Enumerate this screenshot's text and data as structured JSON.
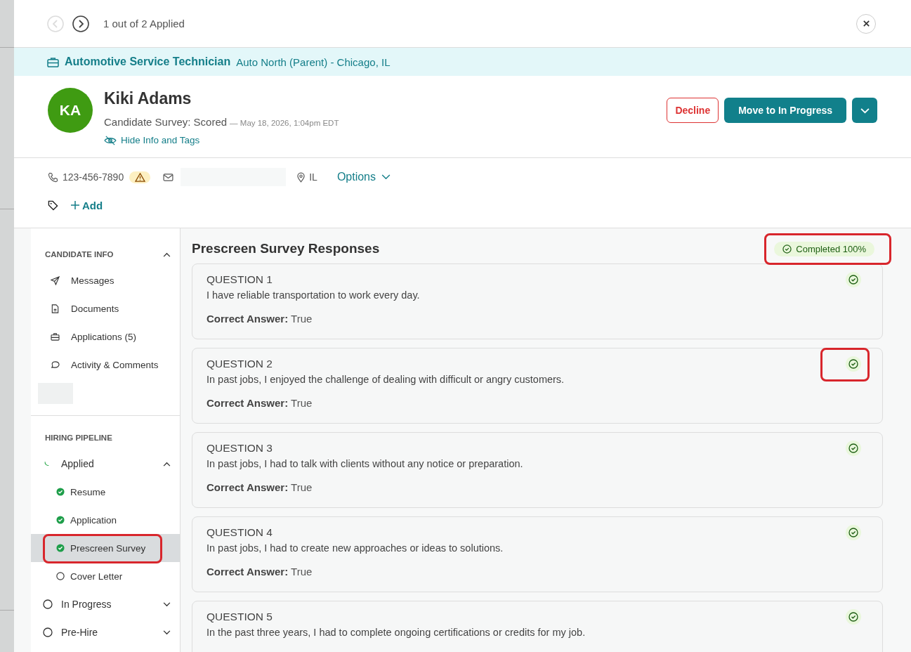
{
  "header": {
    "pager": "1 out of 2 Applied",
    "prev_disabled": true
  },
  "job": {
    "title": "Automotive Service Technician",
    "location": "Auto North (Parent) - Chicago, IL"
  },
  "candidate": {
    "initials": "KA",
    "name": "Kiki Adams",
    "status": "Candidate Survey: Scored",
    "timestamp": "— May 18, 2026, 1:04pm EDT",
    "toggle": "Hide Info and Tags"
  },
  "actions": {
    "decline": "Decline",
    "primary": "Move to In Progress"
  },
  "contact": {
    "phone": "123-456-7890",
    "phone_warning": true,
    "state": "IL",
    "options": "Options",
    "add_tag": "Add"
  },
  "sidebar": {
    "candidate_info": {
      "title": "CANDIDATE INFO",
      "expanded": true,
      "items": [
        {
          "label": "Messages",
          "kind": "messages"
        },
        {
          "label": "Documents",
          "kind": "documents"
        },
        {
          "label": "Applications (5)",
          "kind": "applications"
        },
        {
          "label": "Activity & Comments",
          "kind": "activity"
        }
      ]
    },
    "hiring_pipeline": {
      "title": "HIRING PIPELINE",
      "stages": [
        {
          "label": "Applied",
          "kind": "current",
          "expanded": true,
          "children": [
            {
              "label": "Resume",
              "kind": "done",
              "selected": false,
              "highlight": false
            },
            {
              "label": "Application",
              "kind": "done",
              "selected": false,
              "highlight": false
            },
            {
              "label": "Prescreen Survey",
              "kind": "done",
              "selected": true,
              "highlight": true
            },
            {
              "label": "Cover Letter",
              "kind": "pending",
              "selected": false,
              "highlight": false
            }
          ]
        },
        {
          "label": "In Progress",
          "kind": "pending",
          "expanded": false
        },
        {
          "label": "Pre-Hire",
          "kind": "pending",
          "expanded": false
        }
      ]
    }
  },
  "survey": {
    "title": "Prescreen Survey Responses",
    "completion": "Completed 100%",
    "completion_highlight": true,
    "questions": [
      {
        "title": "QUESTION 1",
        "text": "I have reliable transportation to work every day.",
        "answer_label": "Correct Answer:",
        "answer": "True",
        "correct": true,
        "highlight": false
      },
      {
        "title": "QUESTION 2",
        "text": "In past jobs, I enjoyed the challenge of dealing with difficult or angry customers.",
        "answer_label": "Correct Answer:",
        "answer": "True",
        "correct": true,
        "highlight": true
      },
      {
        "title": "QUESTION 3",
        "text": "In past jobs, I had to talk with clients without any notice or preparation.",
        "answer_label": "Correct Answer:",
        "answer": "True",
        "correct": true,
        "highlight": false
      },
      {
        "title": "QUESTION 4",
        "text": "In past jobs, I had to create new approaches or ideas to solutions.",
        "answer_label": "Correct Answer:",
        "answer": "True",
        "correct": true,
        "highlight": false
      },
      {
        "title": "QUESTION 5",
        "text": "In the past three years, I had to complete ongoing certifications or credits for my job.",
        "correct": true,
        "highlight": false
      }
    ]
  }
}
